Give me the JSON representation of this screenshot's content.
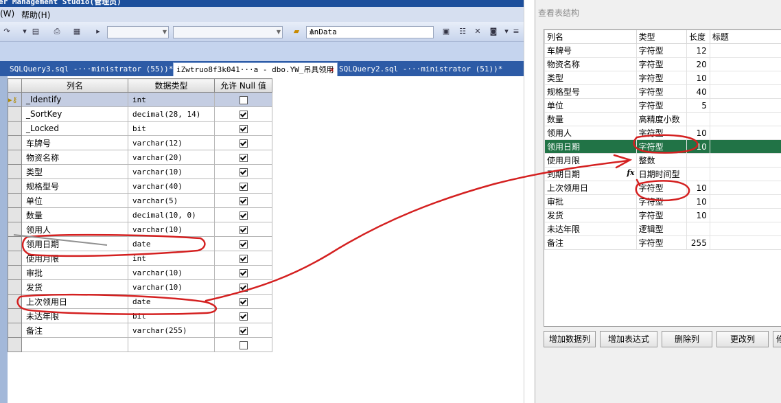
{
  "ssms": {
    "title": "er Management Studio(管理员)",
    "menu": {
      "window_fragment": "(W)",
      "help": "帮助(H)"
    },
    "toolbar": {
      "database": "AnData"
    },
    "tabs": [
      {
        "label": "SQLQuery3.sql -···ministrator (55))*"
      },
      {
        "label": "iZwtruo8f3k041···a - dbo.YW_吊具领用"
      },
      {
        "label": "SQLQuery2.sql -···ministrator (51))*"
      }
    ],
    "tab_close": "✕",
    "grid": {
      "headers": [
        "列名",
        "数据类型",
        "允许 Null 值"
      ],
      "rows": [
        {
          "name": "_Identify",
          "type": "int",
          "nullable": false,
          "key": true
        },
        {
          "name": "_SortKey",
          "type": "decimal(28, 14)",
          "nullable": true
        },
        {
          "name": "_Locked",
          "type": "bit",
          "nullable": true
        },
        {
          "name": "车牌号",
          "type": "varchar(12)",
          "nullable": true
        },
        {
          "name": "物资名称",
          "type": "varchar(20)",
          "nullable": true
        },
        {
          "name": "类型",
          "type": "varchar(10)",
          "nullable": true
        },
        {
          "name": "规格型号",
          "type": "varchar(40)",
          "nullable": true
        },
        {
          "name": "单位",
          "type": "varchar(5)",
          "nullable": true
        },
        {
          "name": "数量",
          "type": "decimal(10, 0)",
          "nullable": true
        },
        {
          "name": "领用人",
          "type": "varchar(10)",
          "nullable": true
        },
        {
          "name": "领用日期",
          "type": "date",
          "nullable": true
        },
        {
          "name": "使用月限",
          "type": "int",
          "nullable": true
        },
        {
          "name": "审批",
          "type": "varchar(10)",
          "nullable": true
        },
        {
          "name": "发货",
          "type": "varchar(10)",
          "nullable": true
        },
        {
          "name": "上次领用日",
          "type": "date",
          "nullable": true
        },
        {
          "name": "未达年限",
          "type": "bit",
          "nullable": true
        },
        {
          "name": "备注",
          "type": "varchar(255)",
          "nullable": true
        },
        {
          "name": "",
          "type": "",
          "nullable": false
        }
      ]
    }
  },
  "panel": {
    "title": "查看表结构",
    "headers": [
      "列名",
      "类型",
      "长度",
      "标题"
    ],
    "rows": [
      {
        "name": "车牌号",
        "type": "字符型",
        "length": "12"
      },
      {
        "name": "物资名称",
        "type": "字符型",
        "length": "20"
      },
      {
        "name": "类型",
        "type": "字符型",
        "length": "10"
      },
      {
        "name": "规格型号",
        "type": "字符型",
        "length": "40"
      },
      {
        "name": "单位",
        "type": "字符型",
        "length": "5"
      },
      {
        "name": "数量",
        "type": "高精度小数",
        "length": ""
      },
      {
        "name": "领用人",
        "type": "字符型",
        "length": "10"
      },
      {
        "name": "领用日期",
        "type": "字符型",
        "length": "10",
        "highlight": true
      },
      {
        "name": "使用月限",
        "type": "整数",
        "length": ""
      },
      {
        "name": "到期日期",
        "type": "日期时间型",
        "length": "",
        "fx": true
      },
      {
        "name": "上次领用日",
        "type": "字符型",
        "length": "10"
      },
      {
        "name": "审批",
        "type": "字符型",
        "length": "10"
      },
      {
        "name": "发货",
        "type": "字符型",
        "length": "10"
      },
      {
        "name": "未达年限",
        "type": "逻辑型",
        "length": ""
      },
      {
        "name": "备注",
        "type": "字符型",
        "length": "255"
      }
    ],
    "fx_symbol": "fx",
    "buttons": [
      "增加数据列",
      "增加表达式",
      "删除列",
      "更改列",
      "修"
    ]
  },
  "colors": {
    "title_bar": "#1c4f9c",
    "tab_strip": "#2d5ba6",
    "highlight_row": "#217346",
    "annotation": "#d42020"
  }
}
